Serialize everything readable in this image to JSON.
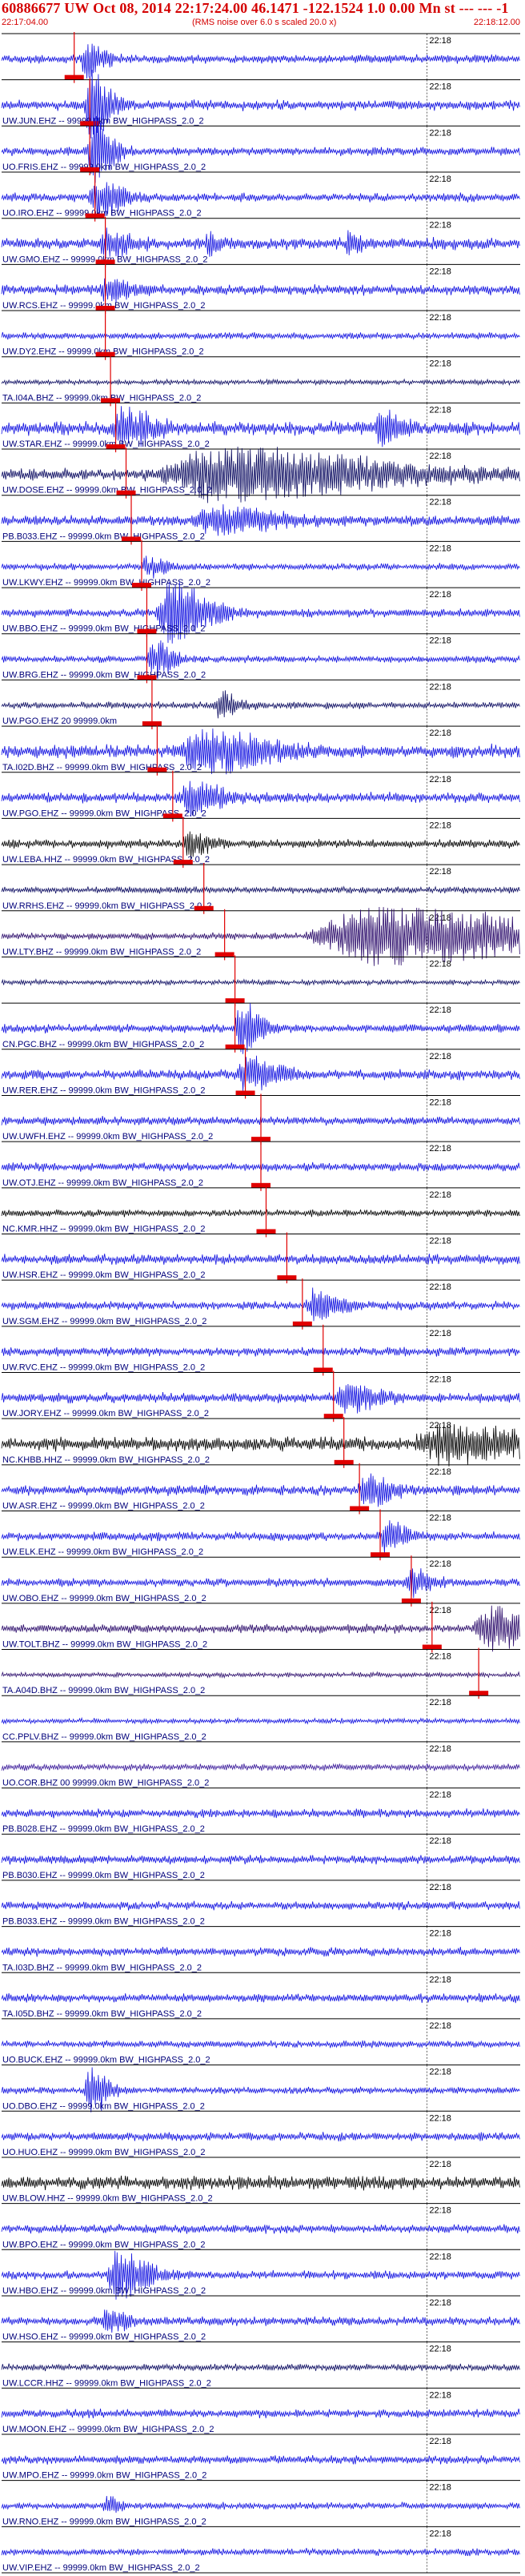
{
  "header": {
    "title": "60886677 UW Oct 08, 2014 22:17:24.00   46.1471 -122.1524  1.0 0.00 Mn st --- --- -1",
    "start_time": "22:17:04.00",
    "end_time": "22:18:12.00",
    "rms_note": "(RMS noise over 6.0 s scaled 20.0 x)"
  },
  "chart_data": {
    "type": "line",
    "title": "60886677 UW Oct 08, 2014 22:17:24.00   46.1471 -122.1524  1.0 0.00 Mn st --- --- -1",
    "x_range": [
      "22:17:04.00",
      "22:18:12.00"
    ],
    "minute_tick_label": "22:18",
    "colors": {
      "pick": "#e00000",
      "blue": "#1010e0",
      "navy": "#0a0a60",
      "dark_purple": "#2a0a6a",
      "black": "#000000",
      "purple": "#3a1a9a"
    },
    "traces": [
      {
        "label": "",
        "color": "blue",
        "noise": 0.5,
        "events": [
          [
            0.16,
            1.6,
            0.03
          ]
        ],
        "pick": 0.14
      },
      {
        "label": "UW.JUN.EHZ -- 99999.0km BW_HIGHPASS_2.0_2",
        "color": "blue",
        "noise": 0.6,
        "events": [
          [
            0.17,
            3.5,
            0.03
          ]
        ],
        "pick": 0.17
      },
      {
        "label": "UO.FRIS.EHZ -- 99999.0km BW_HIGHPASS_2.0_2",
        "color": "blue",
        "noise": 0.5,
        "events": [
          [
            0.175,
            3.5,
            0.03
          ]
        ],
        "pick": 0.17
      },
      {
        "label": "UO.IRO.EHZ -- 99999.0km BW_HIGHPASS_2.0_2",
        "color": "blue",
        "noise": 0.5,
        "events": [
          [
            0.18,
            2.0,
            0.04
          ]
        ],
        "pick": 0.18
      },
      {
        "label": "UW.GMO.EHZ -- 99999.0km BW_HIGHPASS_2.0_2",
        "color": "blue",
        "noise": 0.7,
        "events": [
          [
            0.2,
            1.2,
            0.04
          ],
          [
            0.4,
            1.0,
            0.02
          ],
          [
            0.67,
            1.0,
            0.02
          ]
        ],
        "pick": 0.2
      },
      {
        "label": "UW.RCS.EHZ -- 99999.0km BW_HIGHPASS_2.0_2",
        "color": "blue",
        "noise": 0.6,
        "events": [
          [
            0.2,
            1.0,
            0.04
          ]
        ],
        "pick": 0.2
      },
      {
        "label": "UW.DY2.EHZ -- 99999.0km BW_HIGHPASS_2.0_2",
        "color": "blue",
        "noise": 0.4,
        "events": [],
        "pick": 0.2
      },
      {
        "label": "TA.I04A.BHZ -- 99999.0km BW_HIGHPASS_2.0_2",
        "color": "navy",
        "noise": 0.3,
        "events": [],
        "pick": 0.21
      },
      {
        "label": "UW.STAR.EHZ -- 99999.0km BW_HIGHPASS_2.0_2",
        "color": "blue",
        "noise": 0.8,
        "events": [
          [
            0.23,
            1.8,
            0.05
          ],
          [
            0.73,
            1.4,
            0.03
          ]
        ],
        "pick": 0.22
      },
      {
        "label": "UW.DOSE.EHZ -- 99999.0km BW_HIGHPASS_2.0_2",
        "color": "navy",
        "noise": 0.7,
        "events": [
          [
            0.4,
            2.5,
            0.25
          ]
        ],
        "pick": 0.24
      },
      {
        "label": "PB.B033.EHZ -- 99999.0km BW_HIGHPASS_2.0_2",
        "color": "blue",
        "noise": 0.6,
        "events": [
          [
            0.4,
            1.3,
            0.1
          ]
        ],
        "pick": 0.25
      },
      {
        "label": "UW.LKWY.EHZ -- 99999.0km BW_HIGHPASS_2.0_2",
        "color": "blue",
        "noise": 0.4,
        "events": [
          [
            0.28,
            1.0,
            0.03
          ]
        ],
        "pick": 0.27
      },
      {
        "label": "UW.BBO.EHZ -- 99999.0km BW_HIGHPASS_2.0_2",
        "color": "blue",
        "noise": 0.5,
        "events": [
          [
            0.32,
            3.0,
            0.06
          ]
        ],
        "pick": 0.28
      },
      {
        "label": "UW.BRG.EHZ -- 99999.0km BW_HIGHPASS_2.0_2",
        "color": "blue",
        "noise": 0.4,
        "events": [
          [
            0.29,
            2.0,
            0.03
          ]
        ],
        "pick": 0.28
      },
      {
        "label": "UW.PGO.EHZ 20 99999.0km",
        "color": "navy",
        "noise": 0.4,
        "events": [
          [
            0.42,
            1.3,
            0.03
          ]
        ],
        "pick": 0.29
      },
      {
        "label": "TA.I02D.BHZ -- 99999.0km BW_HIGHPASS_2.0_2",
        "color": "blue",
        "noise": 0.8,
        "events": [
          [
            0.38,
            2.0,
            0.1
          ]
        ],
        "pick": 0.3
      },
      {
        "label": "UW.PGO.EHZ -- 99999.0km BW_HIGHPASS_2.0_2",
        "color": "blue",
        "noise": 0.6,
        "events": [
          [
            0.36,
            1.5,
            0.05
          ]
        ],
        "pick": 0.33
      },
      {
        "label": "UW.LEBA.HHZ -- 99999.0km BW_HIGHPASS_2.0_2",
        "color": "black",
        "noise": 0.5,
        "events": [
          [
            0.36,
            1.2,
            0.03
          ]
        ],
        "pick": 0.35
      },
      {
        "label": "UW.RRHS.EHZ -- 99999.0km BW_HIGHPASS_2.0_2",
        "color": "navy",
        "noise": 0.4,
        "events": [],
        "pick": 0.39
      },
      {
        "label": "UW.LTY.BHZ -- 99999.0km BW_HIGHPASS_2.0_2",
        "color": "dark_purple",
        "noise": 0.4,
        "events": [
          [
            0.7,
            2.8,
            0.3
          ]
        ],
        "pick": 0.43
      },
      {
        "label": "",
        "color": "navy",
        "noise": 0.3,
        "events": [],
        "pick": 0.45
      },
      {
        "label": "CN.PGC.BHZ -- 99999.0km BW_HIGHPASS_2.0_2",
        "color": "blue",
        "noise": 0.5,
        "events": [
          [
            0.46,
            2.8,
            0.03
          ]
        ],
        "pick": 0.45
      },
      {
        "label": "UW.RER.EHZ -- 99999.0km BW_HIGHPASS_2.0_2",
        "color": "blue",
        "noise": 0.6,
        "events": [
          [
            0.47,
            1.6,
            0.05
          ]
        ],
        "pick": 0.47
      },
      {
        "label": "UW.UWFH.EHZ -- 99999.0km BW_HIGHPASS_2.0_2",
        "color": "blue",
        "noise": 0.5,
        "events": [],
        "pick": 0.5
      },
      {
        "label": "UW.OTJ.EHZ -- 99999.0km BW_HIGHPASS_2.0_2",
        "color": "blue",
        "noise": 0.5,
        "events": [],
        "pick": 0.5
      },
      {
        "label": "NC.KMR.HHZ -- 99999.0km BW_HIGHPASS_2.0_2",
        "color": "black",
        "noise": 0.4,
        "events": [],
        "pick": 0.51
      },
      {
        "label": "UW.HSR.EHZ -- 99999.0km BW_HIGHPASS_2.0_2",
        "color": "blue",
        "noise": 0.6,
        "events": [],
        "pick": 0.55
      },
      {
        "label": "UW.SGM.EHZ -- 99999.0km BW_HIGHPASS_2.0_2",
        "color": "blue",
        "noise": 0.5,
        "events": [
          [
            0.6,
            1.4,
            0.04
          ]
        ],
        "pick": 0.58
      },
      {
        "label": "UW.RVC.EHZ -- 99999.0km BW_HIGHPASS_2.0_2",
        "color": "blue",
        "noise": 0.5,
        "events": [],
        "pick": 0.62
      },
      {
        "label": "UW.JORY.EHZ -- 99999.0km BW_HIGHPASS_2.0_2",
        "color": "blue",
        "noise": 0.6,
        "events": [
          [
            0.66,
            1.3,
            0.05
          ]
        ],
        "pick": 0.64
      },
      {
        "label": "NC.KHBB.HHZ -- 99999.0km BW_HIGHPASS_2.0_2",
        "color": "black",
        "noise": 0.8,
        "events": [
          [
            0.85,
            1.6,
            0.15
          ]
        ],
        "pick": 0.66
      },
      {
        "label": "UW.ASR.EHZ -- 99999.0km BW_HIGHPASS_2.0_2",
        "color": "blue",
        "noise": 0.6,
        "events": [
          [
            0.7,
            1.5,
            0.04
          ]
        ],
        "pick": 0.69
      },
      {
        "label": "UW.ELK.EHZ -- 99999.0km BW_HIGHPASS_2.0_2",
        "color": "blue",
        "noise": 0.5,
        "events": [
          [
            0.74,
            1.4,
            0.03
          ]
        ],
        "pick": 0.73
      },
      {
        "label": "UW.OBO.EHZ -- 99999.0km BW_HIGHPASS_2.0_2",
        "color": "blue",
        "noise": 0.5,
        "events": [
          [
            0.79,
            1.4,
            0.03
          ]
        ],
        "pick": 0.79
      },
      {
        "label": "UW.TOLT.BHZ -- 99999.0km BW_HIGHPASS_2.0_2",
        "color": "dark_purple",
        "noise": 0.5,
        "events": [
          [
            0.94,
            2.2,
            0.08
          ]
        ],
        "pick": 0.83
      },
      {
        "label": "TA.A04D.BHZ -- 99999.0km BW_HIGHPASS_2.0_2",
        "color": "dark_purple",
        "noise": 0.3,
        "events": [],
        "pick": 0.92
      },
      {
        "label": "CC.PPLV.BHZ -- 99999.0km BW_HIGHPASS_2.0_2",
        "color": "blue",
        "noise": 0.3,
        "events": [],
        "pick": null
      },
      {
        "label": "UO.COR.BHZ 00 99999.0km BW_HIGHPASS_2.0_2",
        "color": "purple",
        "noise": 0.4,
        "events": [],
        "pick": null
      },
      {
        "label": "PB.B028.EHZ -- 99999.0km BW_HIGHPASS_2.0_2",
        "color": "blue",
        "noise": 0.5,
        "events": [],
        "pick": null
      },
      {
        "label": "PB.B030.EHZ -- 99999.0km BW_HIGHPASS_2.0_2",
        "color": "blue",
        "noise": 0.5,
        "events": [],
        "pick": null
      },
      {
        "label": "PB.B033.EHZ -- 99999.0km BW_HIGHPASS_2.0_2",
        "color": "blue",
        "noise": 0.5,
        "events": [],
        "pick": null
      },
      {
        "label": "TA.I03D.BHZ -- 99999.0km BW_HIGHPASS_2.0_2",
        "color": "blue",
        "noise": 0.5,
        "events": [],
        "pick": null
      },
      {
        "label": "TA.I05D.BHZ -- 99999.0km BW_HIGHPASS_2.0_2",
        "color": "blue",
        "noise": 0.5,
        "events": [],
        "pick": null
      },
      {
        "label": "UO.BUCK.EHZ -- 99999.0km BW_HIGHPASS_2.0_2",
        "color": "blue",
        "noise": 0.4,
        "events": [],
        "pick": null
      },
      {
        "label": "UO.DBO.EHZ -- 99999.0km BW_HIGHPASS_2.0_2",
        "color": "blue",
        "noise": 0.4,
        "events": [
          [
            0.17,
            2.5,
            0.03
          ]
        ],
        "pick": null
      },
      {
        "label": "UO.HUO.EHZ -- 99999.0km BW_HIGHPASS_2.0_2",
        "color": "blue",
        "noise": 0.5,
        "events": [],
        "pick": null
      },
      {
        "label": "UW.BLOW.HHZ -- 99999.0km BW_HIGHPASS_2.0_2",
        "color": "black",
        "noise": 0.8,
        "events": [],
        "pick": null
      },
      {
        "label": "UW.BPO.EHZ -- 99999.0km BW_HIGHPASS_2.0_2",
        "color": "blue",
        "noise": 0.5,
        "events": [],
        "pick": null
      },
      {
        "label": "UW.HBO.EHZ -- 99999.0km BW_HIGHPASS_2.0_2",
        "color": "blue",
        "noise": 0.5,
        "events": [
          [
            0.22,
            2.2,
            0.05
          ]
        ],
        "pick": null
      },
      {
        "label": "UW.HSO.EHZ -- 99999.0km BW_HIGHPASS_2.0_2",
        "color": "blue",
        "noise": 0.5,
        "events": [
          [
            0.2,
            1.2,
            0.03
          ]
        ],
        "pick": null
      },
      {
        "label": "UW.LCCR.HHZ -- 99999.0km BW_HIGHPASS_2.0_2",
        "color": "navy",
        "noise": 0.4,
        "events": [],
        "pick": null
      },
      {
        "label": "UW.MOON.EHZ -- 99999.0km BW_HIGHPASS_2.0_2",
        "color": "blue",
        "noise": 0.5,
        "events": [],
        "pick": null
      },
      {
        "label": "UW.MPO.EHZ -- 99999.0km BW_HIGHPASS_2.0_2",
        "color": "blue",
        "noise": 0.5,
        "events": [],
        "pick": null
      },
      {
        "label": "UW.RNO.EHZ -- 99999.0km BW_HIGHPASS_2.0_2",
        "color": "blue",
        "noise": 0.4,
        "events": [
          [
            0.2,
            1.0,
            0.02
          ]
        ],
        "pick": null
      },
      {
        "label": "UW.VIP.EHZ -- 99999.0km BW_HIGHPASS_2.0_2",
        "color": "blue",
        "noise": 0.4,
        "events": [],
        "pick": null
      }
    ]
  }
}
